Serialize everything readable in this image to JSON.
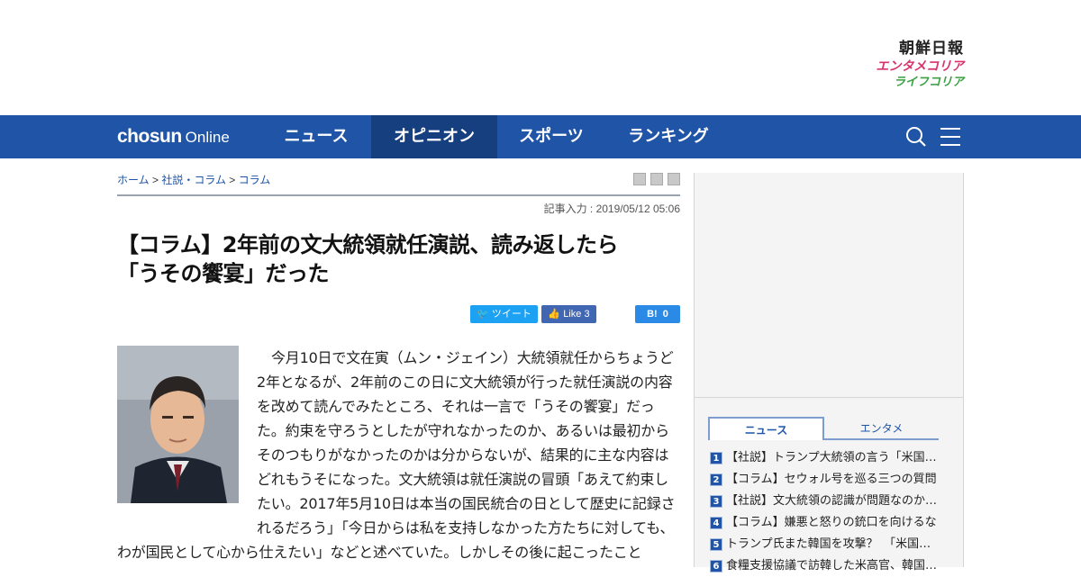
{
  "brands": {
    "chosun_ilbo": "朝鮮日報",
    "entame_korea": "エンタメコリア",
    "life_korea": "ライフコリア"
  },
  "nav": {
    "logo_bold": "chosun",
    "logo_light": "Online",
    "items": [
      {
        "label": "ニュース"
      },
      {
        "label": "オピニオン"
      },
      {
        "label": "スポーツ"
      },
      {
        "label": "ランキング"
      }
    ],
    "icons": [
      "search-icon",
      "menu-icon"
    ]
  },
  "breadcrumb": {
    "home": "ホーム",
    "sep": " > ",
    "level1": "社説・コラム",
    "level2": "コラム"
  },
  "article": {
    "date": "記事入力 : 2019/05/12 05:06",
    "headline_line1": "【コラム】2年前の文大統領就任演説、読み返したら",
    "headline_line2": "「うその饗宴」だった",
    "body": "今月10日で文在寅（ムン・ジェイン）大統領就任からちょうど2年となるが、2年前のこの日に文大統領が行った就任演説の内容を改めて読んでみたところ、それは一言で「うその饗宴」だった。約束を守ろうとしたが守れなかったのか、あるいは最初からそのつもりがなかったのかは分からないが、結果的に主な内容はどれもうそになった。文大統領は就任演説の冒頭「あえて約束したい。2017年5月10日は本当の国民統合の日として歴史に記録されるだろう」「今日からは私を支持しなかった方たちに対しても、わが国民として心から仕えたい」などと述べていた。しかしその後に起こったこと"
  },
  "share": {
    "tweet": "ツイート",
    "like": "Like",
    "like_count": "3",
    "hatena": "B!",
    "hatena_count": "0"
  },
  "sidebar": {
    "tabs": [
      {
        "label": "ニュース",
        "active": true
      },
      {
        "label": "エンタメ",
        "active": false
      }
    ],
    "ranking": [
      {
        "rank": "1",
        "title": "【社説】トランプ大統領の言う「米国…"
      },
      {
        "rank": "2",
        "title": "【コラム】セウォル号を巡る三つの質問"
      },
      {
        "rank": "3",
        "title": "【社説】文大統領の認識が問題なのか…"
      },
      {
        "rank": "4",
        "title": "【コラム】嫌悪と怒りの銃口を向けるな"
      },
      {
        "rank": "5",
        "title": "トランプ氏また韓国を攻撃？　「米国…"
      },
      {
        "rank": "6",
        "title": "食糧支援協議で訪韓した米高官、韓国…"
      }
    ]
  },
  "colors": {
    "nav_bg": "#1f54a6",
    "nav_active": "#163f80",
    "twitter": "#1da1f2",
    "facebook": "#4267b2",
    "hatena": "#2a8ae6",
    "entame": "#d6336c",
    "life": "#3aa041"
  }
}
